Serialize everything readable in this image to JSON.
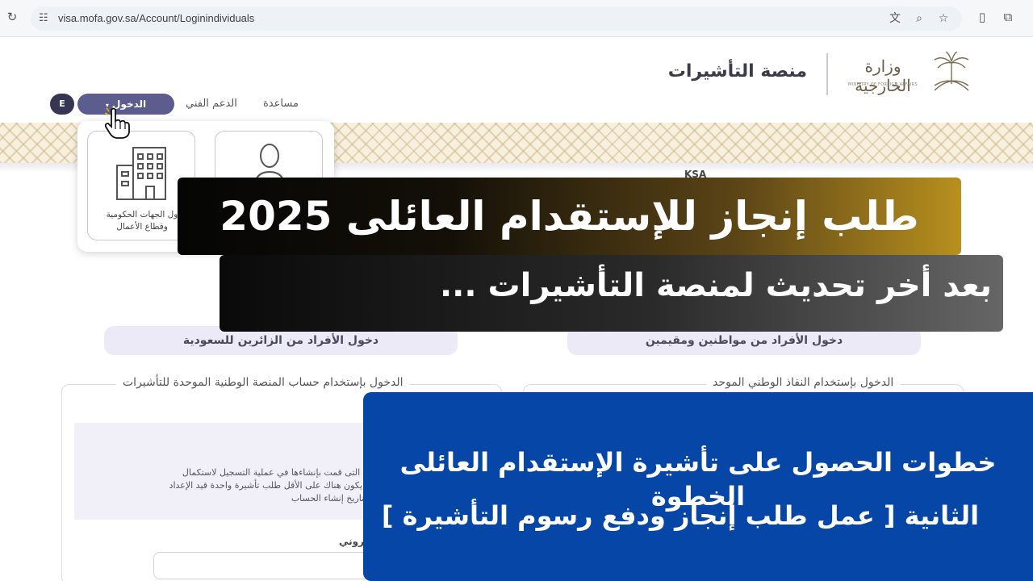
{
  "browser": {
    "url": "visa.mofa.gov.sa/Account/Loginindividuals",
    "icons": [
      "reload-icon",
      "tune-icon",
      "translate-icon",
      "zoom-icon",
      "bookmark-star-icon",
      "extension-icon",
      "puzzle-icon"
    ]
  },
  "header": {
    "site_title": "منصة التأشيرات",
    "ministry_name_ar": "وزارة الخارجية",
    "ministry_name_en": "MINISTRY OF FOREIGN AFFAIRS"
  },
  "nav": {
    "help": "مساعدة",
    "support": "الدعم الفني",
    "login": "الدخول",
    "lang": "E"
  },
  "dropdown": {
    "business_label_line1": "ول الجهات الحكومية",
    "business_label_line2": "وقطاع الأعمال"
  },
  "ksa_tag": "KSA",
  "login_page": {
    "citizens_pill": "دخول الأفراد من مواطنين ومقيمين",
    "visitors_pill": "دخول الأفراد من الزائرين للسعودية",
    "nafath_legend": "الدخول بإستخدام النفاذ الوطني الموحد",
    "platform_legend": "الدخول بإستخدام حساب المنصة الوطنية الموحدة للتأشيرات",
    "info_line1": "التسجيل التى قمت بإنشاءها في عملية التسجيل لاستكمال",
    "info_line2": "يجب أن يكون هناك على الأقل طلب تأشيرة واحدة قيد الإعداد",
    "info_line3": "يوم من تاريخ إنشاء الحساب",
    "email_label": "روني"
  },
  "overlay": {
    "headline": "طلب إنجاز للإستقدام العائلى 2025",
    "subheadline": "بعد أخر تحديث لمنصة التأشيرات ...",
    "steps_line1": "خطوات الحصول على تأشيرة الإستقدام العائلى الخطوة",
    "steps_line2": "الثانية [ عمل طلب إنجاز ودفع رسوم التأشيرة ]"
  },
  "colors": {
    "login_button": "#5d5c8f",
    "lang_button": "#363552",
    "pill_bg": "#eceaf6",
    "steps_bg": "#0646a7",
    "headline_gold": "#b8901e"
  }
}
